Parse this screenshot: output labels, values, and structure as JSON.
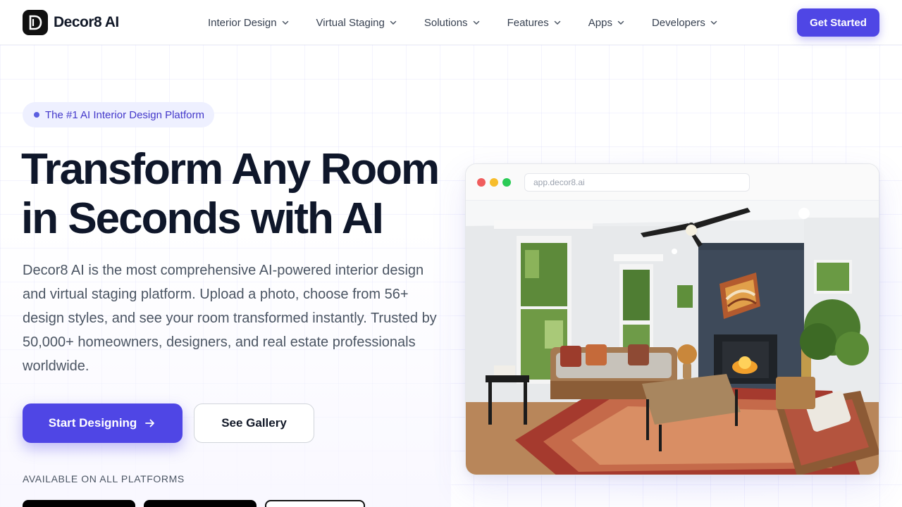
{
  "header": {
    "logo_text": "Decor8 AI",
    "logo_letter": "D",
    "nav": [
      {
        "label": "Interior Design"
      },
      {
        "label": "Virtual Staging"
      },
      {
        "label": "Solutions"
      },
      {
        "label": "Features"
      },
      {
        "label": "Apps"
      },
      {
        "label": "Developers"
      }
    ],
    "cta_label": "Get Started"
  },
  "hero": {
    "badge": "The #1 AI Interior Design Platform",
    "headline_line1": "Transform Any Room",
    "headline_line2": "in Seconds with AI",
    "description": "Decor8 AI is the most comprehensive AI-powered interior design and virtual staging platform. Upload a photo, choose from 56+ design styles, and see your room transformed instantly. Trusted by 50,000+ homeowners, designers, and real estate professionals worldwide.",
    "primary_button": "Start Designing",
    "secondary_button": "See Gallery",
    "platforms_label": "AVAILABLE ON ALL PLATFORMS"
  },
  "browser": {
    "url": "app.decor8.ai"
  },
  "colors": {
    "accent": "#4f46e5",
    "badge_bg": "#eef0ff",
    "text_dark": "#0f172a",
    "text_muted": "#4b5563"
  },
  "icons": {
    "nav_chevron": "chevron-down-icon",
    "primary_arrow": "arrow-right-icon"
  }
}
